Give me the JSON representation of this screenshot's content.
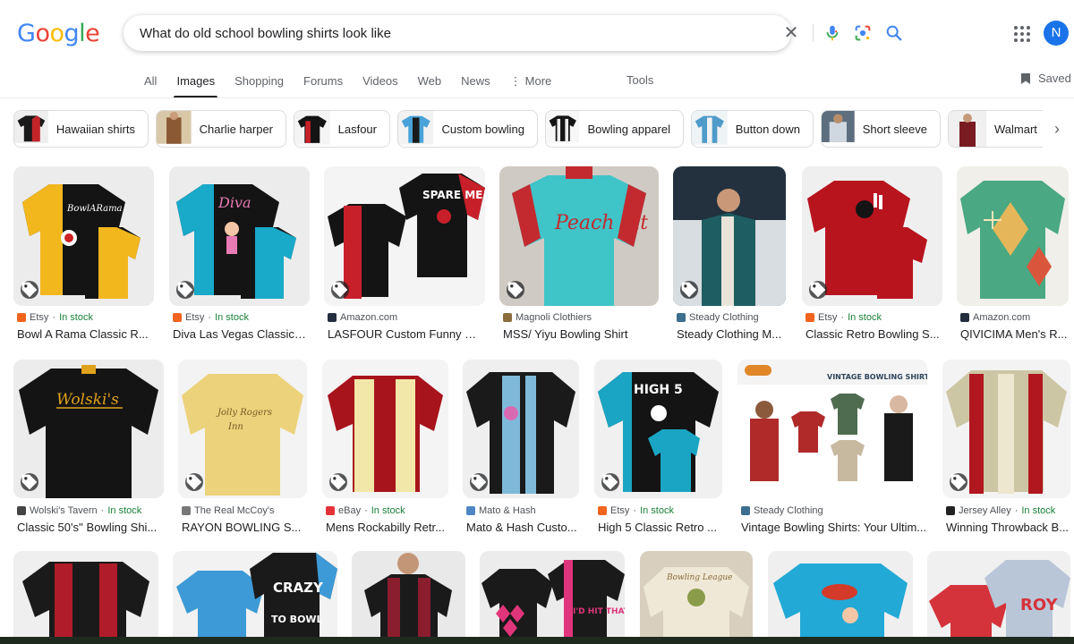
{
  "logo": {
    "letters": [
      "G",
      "o",
      "o",
      "g",
      "l",
      "e"
    ],
    "colors": [
      "#4285F4",
      "#EA4335",
      "#FBBC05",
      "#4285F4",
      "#34A853",
      "#EA4335"
    ]
  },
  "search": {
    "value": "What do old school bowling shirts look like",
    "clear_glyph": "✕"
  },
  "icons": {
    "clear": "close-icon",
    "voice": "microphone-icon",
    "lens": "camera-lens-icon",
    "search": "search-icon",
    "apps": "apps-grid-icon",
    "saved": "bookmark-icon",
    "chip_next": "chevron-right-icon",
    "tag": "tag-icon"
  },
  "account": {
    "initial": "N",
    "color": "#1a73e8"
  },
  "tabs": [
    {
      "label": "All"
    },
    {
      "label": "Images"
    },
    {
      "label": "Shopping"
    },
    {
      "label": "Forums"
    },
    {
      "label": "Videos"
    },
    {
      "label": "Web"
    },
    {
      "label": "News"
    },
    {
      "label": "More"
    }
  ],
  "tools_label": "Tools",
  "saved_label": "Saved",
  "chips": [
    {
      "label": "Hawaiian shirts"
    },
    {
      "label": "Charlie harper"
    },
    {
      "label": "Lasfour"
    },
    {
      "label": "Custom bowling"
    },
    {
      "label": "Bowling apparel"
    },
    {
      "label": "Button down"
    },
    {
      "label": "Short sleeve"
    },
    {
      "label": "Walmart"
    }
  ],
  "results": [
    {
      "source": "Etsy",
      "stock": "In stock",
      "title": "Bowl A Rama Classic R...",
      "colors": [
        "#1a1a1a",
        "#f3b71e"
      ],
      "fav": "#f1641e"
    },
    {
      "source": "Etsy",
      "stock": "In stock",
      "title": "Diva Las Vegas Classic ...",
      "colors": [
        "#1a1a1a",
        "#19a9c9"
      ],
      "fav": "#f1641e"
    },
    {
      "source": "Amazon.com",
      "stock": "",
      "title": "LASFOUR Custom Funny B...",
      "colors": [
        "#151515",
        "#c8202a"
      ],
      "fav": "#232f3e"
    },
    {
      "source": "Magnoli Clothiers",
      "stock": "",
      "title": "MSS/ Yiyu Bowling Shirt",
      "colors": [
        "#3fc4c8",
        "#c22a2f"
      ],
      "fav": "#8a6d3b"
    },
    {
      "source": "Steady Clothing",
      "stock": "",
      "title": "Steady Clothing M...",
      "colors": [
        "#1e5d62",
        "#e8e4da"
      ],
      "fav": "#3c6e8f"
    },
    {
      "source": "Etsy",
      "stock": "In stock",
      "title": "Classic Retro Bowling S...",
      "colors": [
        "#b8141e",
        "#1a1a1a"
      ],
      "fav": "#f1641e"
    },
    {
      "source": "Amazon.com",
      "stock": "",
      "title": "QIVICIMA Men's R...",
      "colors": [
        "#4aa883",
        "#e6b75a"
      ],
      "fav": "#232f3e"
    },
    {
      "source": "Wolski's Tavern",
      "stock": "In stock",
      "title": "Classic 50's'' Bowling Shi...",
      "colors": [
        "#141414",
        "#e0a21c"
      ],
      "fav": "#444444"
    },
    {
      "source": "The Real McCoy's",
      "stock": "",
      "title": "RAYON BOWLING S...",
      "colors": [
        "#ecd27a",
        "#c9a23e"
      ],
      "fav": "#777777"
    },
    {
      "source": "eBay",
      "stock": "In stock",
      "title": "Mens Rockabilly Retr...",
      "colors": [
        "#a8141c",
        "#f2e7a8"
      ],
      "fav": "#e53238"
    },
    {
      "source": "Mato & Hash",
      "stock": "",
      "title": "Mato & Hash Custo...",
      "colors": [
        "#1a1a1a",
        "#7fb9da"
      ],
      "fav": "#4f87c6"
    },
    {
      "source": "Etsy",
      "stock": "In stock",
      "title": "High 5 Classic Retro ...",
      "colors": [
        "#141414",
        "#1aa5c4"
      ],
      "fav": "#f1641e"
    },
    {
      "source": "Steady Clothing",
      "stock": "",
      "title": "Vintage Bowling Shirts: Your Ultim...",
      "colors": [
        "#b02a2a",
        "#4f6b50"
      ],
      "fav": "#3c6e8f"
    },
    {
      "source": "Jersey Alley",
      "stock": "In stock",
      "title": "Winning Throwback B...",
      "colors": [
        "#b1171f",
        "#cdc6a4"
      ],
      "fav": "#222222"
    },
    {
      "source": "",
      "stock": "",
      "title": "",
      "colors": [
        "#1a1a1a",
        "#b01c2a"
      ],
      "fav": ""
    },
    {
      "source": "",
      "stock": "",
      "title": "",
      "colors": [
        "#1a1a1a",
        "#3d9ad6"
      ],
      "fav": ""
    },
    {
      "source": "",
      "stock": "",
      "title": "",
      "colors": [
        "#1a1a1a",
        "#8a1d2e"
      ],
      "fav": ""
    },
    {
      "source": "",
      "stock": "",
      "title": "",
      "colors": [
        "#1a1a1a",
        "#e0357a"
      ],
      "fav": ""
    },
    {
      "source": "",
      "stock": "",
      "title": "",
      "colors": [
        "#efe8d6",
        "#8a9b4a"
      ],
      "fav": ""
    },
    {
      "source": "",
      "stock": "",
      "title": "",
      "colors": [
        "#22a9d6",
        "#d43a2a"
      ],
      "fav": ""
    },
    {
      "source": "",
      "stock": "",
      "title": "",
      "colors": [
        "#b9c6d8",
        "#d5333b"
      ],
      "fav": ""
    }
  ],
  "image_text": {
    "lasfour": "SPARE ME!",
    "peach": "Peach Pit",
    "wolski": "Wolski's",
    "high5": "HIGH 5",
    "steady_banner": "VINTAGE BOWLING SHIRTS!",
    "crazy": "CRAZY",
    "to_bowl": "TO BOWL",
    "hit": "I'D HIT THAT"
  }
}
